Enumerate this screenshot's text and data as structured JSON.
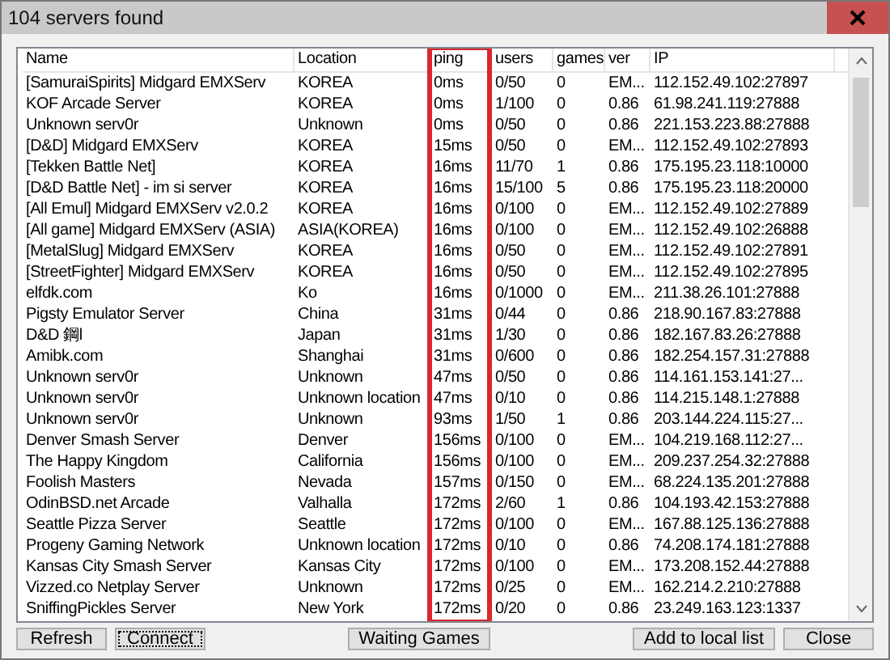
{
  "window": {
    "title": "104 servers found"
  },
  "table": {
    "columns": [
      {
        "label": "Name",
        "highlighted": false
      },
      {
        "label": "Location",
        "highlighted": false
      },
      {
        "label": "ping",
        "highlighted": true
      },
      {
        "label": "users",
        "highlighted": false
      },
      {
        "label": "games",
        "highlighted": false
      },
      {
        "label": "ver",
        "highlighted": false
      },
      {
        "label": "IP",
        "highlighted": false
      }
    ],
    "rows": [
      [
        "[SamuraiSpirits] Midgard EMXServ",
        "KOREA",
        "0ms",
        "0/50",
        "0",
        "EM...",
        "112.152.49.102:27897"
      ],
      [
        "KOF Arcade Server",
        "KOREA",
        "0ms",
        "1/100",
        "0",
        "0.86",
        "61.98.241.119:27888"
      ],
      [
        "Unknown serv0r",
        "Unknown",
        "0ms",
        "0/50",
        "0",
        "0.86",
        "221.153.223.88:27888"
      ],
      [
        "[D&D] Midgard EMXServ",
        "KOREA",
        "15ms",
        "0/50",
        "0",
        "EM...",
        "112.152.49.102:27893"
      ],
      [
        "[Tekken Battle Net]",
        "KOREA",
        "16ms",
        "11/70",
        "1",
        "0.86",
        "175.195.23.118:10000"
      ],
      [
        "[D&D Battle Net] - im si server",
        "KOREA",
        "16ms",
        "15/100",
        "5",
        "0.86",
        "175.195.23.118:20000"
      ],
      [
        "[All Emul] Midgard EMXServ v2.0.2",
        "KOREA",
        "16ms",
        "0/100",
        "0",
        "EM...",
        "112.152.49.102:27889"
      ],
      [
        "[All game] Midgard EMXServ (ASIA)",
        "ASIA(KOREA)",
        "16ms",
        "0/100",
        "0",
        "EM...",
        "112.152.49.102:26888"
      ],
      [
        "[MetalSlug] Midgard EMXServ",
        "KOREA",
        "16ms",
        "0/50",
        "0",
        "EM...",
        "112.152.49.102:27891"
      ],
      [
        "[StreetFighter] Midgard EMXServ",
        "KOREA",
        "16ms",
        "0/50",
        "0",
        "EM...",
        "112.152.49.102:27895"
      ],
      [
        "elfdk.com",
        "Ko",
        "16ms",
        "0/1000",
        "0",
        "EM...",
        "211.38.26.101:27888"
      ],
      [
        "Pigsty Emulator Server",
        "China",
        "31ms",
        "0/44",
        "0",
        "0.86",
        "218.90.167.83:27888"
      ],
      [
        "D&D 鋼l",
        "Japan",
        "31ms",
        "1/30",
        "0",
        "0.86",
        "182.167.83.26:27888"
      ],
      [
        "Amibk.com",
        "Shanghai",
        "31ms",
        "0/600",
        "0",
        "0.86",
        "182.254.157.31:27888"
      ],
      [
        "Unknown serv0r",
        "Unknown",
        "47ms",
        "0/50",
        "0",
        "0.86",
        "114.161.153.141:27..."
      ],
      [
        "Unknown serv0r",
        "Unknown location",
        "47ms",
        "0/10",
        "0",
        "0.86",
        "114.215.148.1:27888"
      ],
      [
        "Unknown serv0r",
        "Unknown",
        "93ms",
        "1/50",
        "1",
        "0.86",
        "203.144.224.115:27..."
      ],
      [
        "Denver Smash Server",
        "Denver",
        "156ms",
        "0/100",
        "0",
        "EM...",
        "104.219.168.112:27..."
      ],
      [
        "The Happy Kingdom",
        "California",
        "156ms",
        "0/100",
        "0",
        "EM...",
        "209.237.254.32:27888"
      ],
      [
        "Foolish Masters",
        "Nevada",
        "157ms",
        "0/150",
        "0",
        "EM...",
        "68.224.135.201:27888"
      ],
      [
        "OdinBSD.net Arcade",
        "Valhalla",
        "172ms",
        "2/60",
        "1",
        "0.86",
        "104.193.42.153:27888"
      ],
      [
        "Seattle Pizza Server",
        "Seattle",
        "172ms",
        "0/100",
        "0",
        "EM...",
        "167.88.125.136:27888"
      ],
      [
        "Progeny Gaming Network",
        "Unknown location",
        "172ms",
        "0/10",
        "0",
        "0.86",
        "74.208.174.181:27888"
      ],
      [
        "Kansas City Smash Server",
        "Kansas City",
        "172ms",
        "0/100",
        "0",
        "EM...",
        "173.208.152.44:27888"
      ],
      [
        "Vizzed.co Netplay Server",
        "Unknown",
        "172ms",
        "0/25",
        "0",
        "EM...",
        "162.214.2.210:27888"
      ],
      [
        "SniffingPickles Server",
        "New York",
        "172ms",
        "0/20",
        "0",
        "0.86",
        "23.249.163.123:1337"
      ]
    ]
  },
  "buttons": [
    {
      "label": "Refresh",
      "focused": false
    },
    {
      "label": "Connect",
      "focused": true
    },
    {
      "label": "Waiting Games",
      "focused": false
    },
    {
      "label": "Add to local list",
      "focused": false
    },
    {
      "label": "Close",
      "focused": false
    }
  ]
}
